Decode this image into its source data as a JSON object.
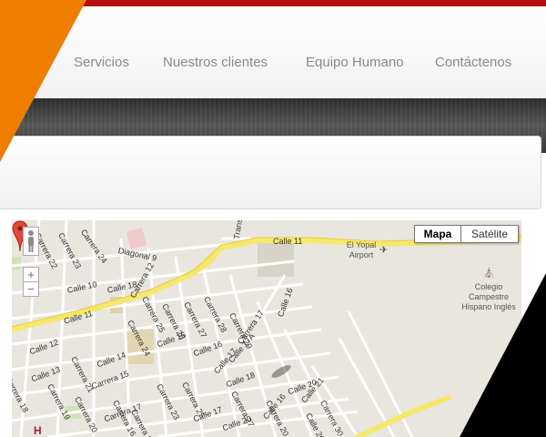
{
  "nav": {
    "items": [
      {
        "label": "Servicios"
      },
      {
        "label": "Nuestros clientes"
      },
      {
        "label": "Equipo Humano"
      },
      {
        "label": "Contáctenos"
      }
    ]
  },
  "map": {
    "type_buttons": {
      "map": "Mapa",
      "satellite": "Satélite"
    },
    "selected_type": "Mapa",
    "zoom_in": "+",
    "zoom_out": "−",
    "arterials": {
      "calle11_top": "Calle 11",
      "calle11_left": "Calle 11"
    },
    "pois": {
      "airport": "El Yopal Airport",
      "school_l1": "Colegio",
      "school_l2": "Campestre",
      "school_l3": "Hispano Inglés",
      "hospital": "H"
    },
    "streets": [
      "Carrera 22",
      "Carrera 23",
      "Carrera 24",
      "Diagonal 9",
      "Transversal 30",
      "Calle 10",
      "Carrera 12",
      "Calle 18",
      "Carrera 26",
      "Carrera 25",
      "Carrera 27",
      "Carrera 28",
      "Carrera 29",
      "Calle 16",
      "Calle 12",
      "Calle 13",
      "Carrera 21",
      "Calle 14",
      "Carrera 24",
      "Calle 15",
      "Carrera 15",
      "Calle 16",
      "Carrera 17",
      "Calle 17A",
      "Calle 17",
      "Carrera 18",
      "Carrera 19",
      "Carrera 20",
      "Carrera 16",
      "Calle 18",
      "Calle 20",
      "Calle 21",
      "Carrera 23",
      "Carrera 25",
      "Carrera 27",
      "Calle 17",
      "Calle 20",
      "Carrera 22",
      "Carrera 30",
      "Carrera 17",
      "Calle 16",
      "Calle 20",
      "Carrera 20"
    ]
  },
  "colors": {
    "topbar": "#b40f0f",
    "orange_accent": "#ef7d00",
    "nav_text": "#8a8a8a",
    "map_road_major": "#f6e86a",
    "map_bg": "#e9e6df"
  },
  "icons": [
    "pegman-icon",
    "zoom-in-icon",
    "zoom-out-icon",
    "airport-icon",
    "school-icon",
    "map-marker-icon",
    "hospital-icon"
  ]
}
